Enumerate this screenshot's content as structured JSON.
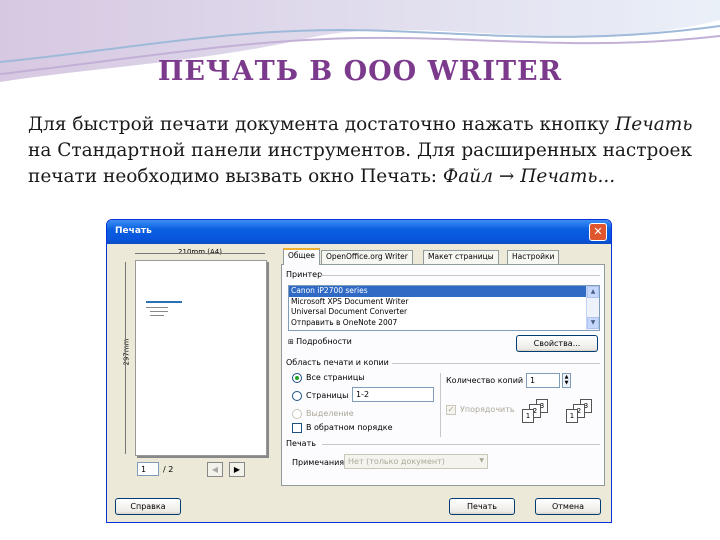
{
  "slide": {
    "title": "ПЕЧАТЬ В OOO WRITER",
    "body": {
      "p1": "Для быстрой печати документа достаточно нажать кнопку ",
      "p2_italic": "Печать",
      "p3": " на Стандартной панели инструментов. Для расширенных настроек печати необходимо вызвать окно Печать: ",
      "p4_italic": "Файл → Печать..."
    }
  },
  "dialog": {
    "title": "Печать",
    "preview": {
      "width_label": "210mm (A4)",
      "height_label": "297mm",
      "page_input": "1",
      "page_total": "/ 2"
    },
    "tabs": [
      "Общее",
      "OpenOffice.org Writer",
      "Макет страницы",
      "Настройки"
    ],
    "printer": {
      "section": "Принтер",
      "items": [
        "Canon iP2700 series",
        "Microsoft XPS Document Writer",
        "Universal Document Converter",
        "Отправить в OneNote 2007"
      ],
      "selected_index": 0,
      "details": "Подробности",
      "properties_button": "Свойства..."
    },
    "range": {
      "section": "Область печати и копии",
      "all_pages": "Все страницы",
      "pages": "Страницы",
      "pages_value": "1-2",
      "selection": "Выделение",
      "reverse": "В обратном порядке",
      "copies_label": "Количество копий",
      "copies_value": "1",
      "collate": "Упорядочить"
    },
    "print_section": {
      "section": "Печать",
      "comments_label": "Примечания",
      "comments_value": "Нет (только документ)"
    },
    "buttons": {
      "help": "Справка",
      "print": "Печать",
      "cancel": "Отмена"
    }
  },
  "colors": {
    "title": "#7b3a8c",
    "titlebar": "#0a5fe0",
    "selection": "#316ac5"
  }
}
